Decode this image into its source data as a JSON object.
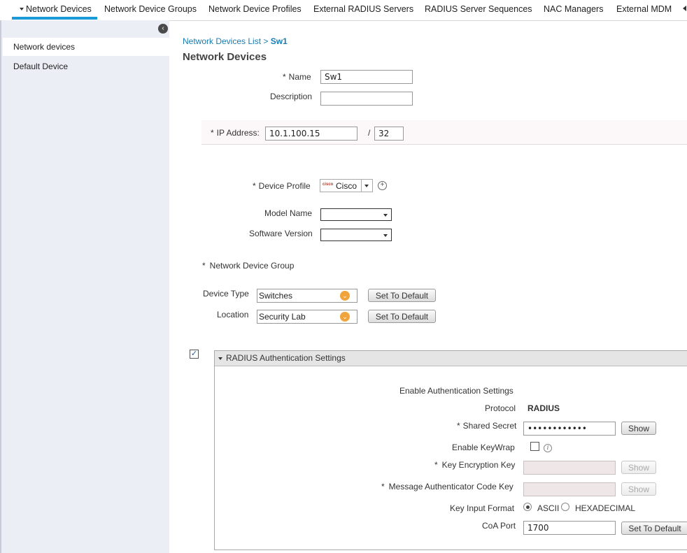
{
  "tabs": [
    {
      "label": "Network Devices",
      "active": true
    },
    {
      "label": "Network Device Groups"
    },
    {
      "label": "Network Device Profiles"
    },
    {
      "label": "External RADIUS Servers"
    },
    {
      "label": "RADIUS Server Sequences"
    },
    {
      "label": "NAC Managers"
    },
    {
      "label": "External MDM"
    }
  ],
  "sidebar": {
    "items": [
      {
        "label": "Network devices",
        "selected": true
      },
      {
        "label": "Default Device"
      }
    ]
  },
  "breadcrumb": {
    "parent": "Network Devices List",
    "separator": ">",
    "current": "Sw1"
  },
  "page_title": "Network Devices",
  "form": {
    "name": {
      "required": "*",
      "label": "Name",
      "value": "Sw1"
    },
    "description": {
      "label": "Description",
      "value": ""
    },
    "ip": {
      "required": "*",
      "label": "IP Address:",
      "value": "10.1.100.15",
      "slash": "/",
      "mask": "32"
    },
    "device_profile": {
      "required": "*",
      "label": "Device Profile",
      "value": "Cisco",
      "logo_text": "cisco"
    },
    "model_name": {
      "label": "Model Name",
      "value": ""
    },
    "software_version": {
      "label": "Software Version",
      "value": ""
    },
    "ndg": {
      "required": "*",
      "label": "Network Device Group"
    },
    "device_type": {
      "label": "Device Type",
      "value": "Switches",
      "button": "Set To Default"
    },
    "location": {
      "label": "Location",
      "value": "Security Lab",
      "button": "Set To Default"
    }
  },
  "radius": {
    "enabled": true,
    "section_title": "RADIUS Authentication Settings",
    "enable_auth_label": "Enable Authentication Settings",
    "protocol_label": "Protocol",
    "protocol_value": "RADIUS",
    "shared_secret": {
      "required": "*",
      "label": "Shared Secret",
      "value": "••••••••••••",
      "button": "Show"
    },
    "keywrap": {
      "label": "Enable KeyWrap",
      "checked": false,
      "info": "i"
    },
    "key_encryption": {
      "required": "*",
      "label": "Key Encryption Key",
      "value": "",
      "button": "Show"
    },
    "mac_key": {
      "required": "*",
      "label": "Message Authenticator Code Key",
      "value": "",
      "button": "Show"
    },
    "key_input_format": {
      "label": "Key Input Format",
      "options": [
        "ASCII",
        "HEXADECIMAL"
      ],
      "selected": "ASCII"
    },
    "coa_port": {
      "label": "CoA Port",
      "value": "1700",
      "button": "Set To Default"
    }
  },
  "colors": {
    "accent": "#1a9ad6",
    "link": "#1a7cb0",
    "sidebar_bg": "#eceef6",
    "combo_orb": "#f1a43c"
  }
}
